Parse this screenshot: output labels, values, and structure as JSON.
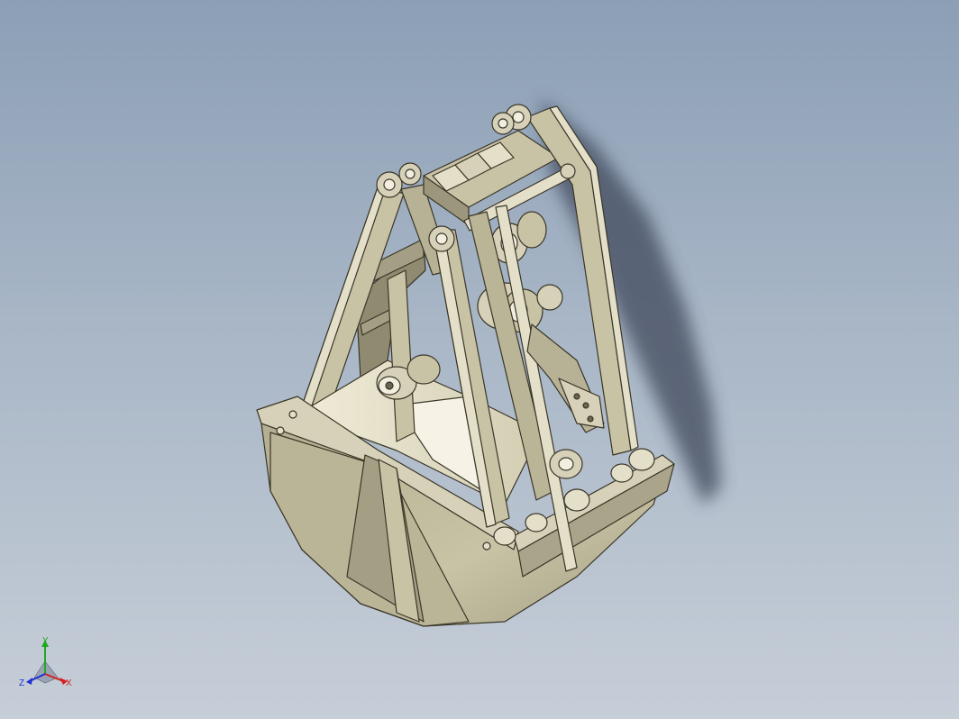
{
  "viewport": {
    "model": "clamshell-grab-bucket",
    "colors": {
      "background_top": "#8c9fb6",
      "background_bottom": "#c6ced8",
      "part_fill": "#c9c3a6",
      "part_shade": "#9c967c",
      "part_light": "#e4dfc8",
      "edge": "#3a3628",
      "shadow": "#4a5566"
    }
  },
  "triad": {
    "x_label": "X",
    "y_label": "Y",
    "z_label": "Z",
    "x_color": "#d42020",
    "y_color": "#1fa81f",
    "z_color": "#2030d0"
  }
}
